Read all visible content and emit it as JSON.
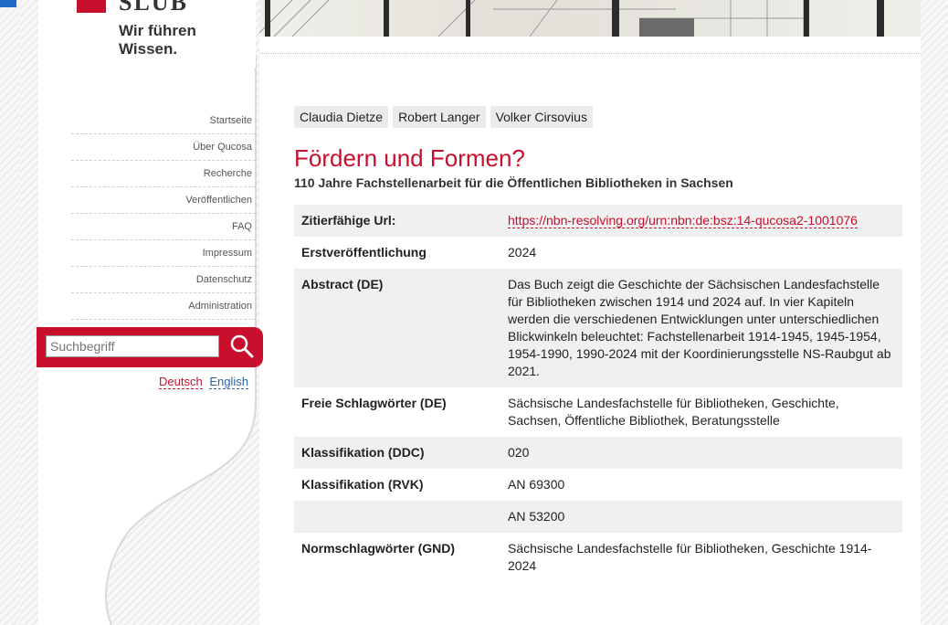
{
  "brand": {
    "logo_word": "SLUB",
    "tagline": "Wir führen Wissen."
  },
  "nav": [
    "Startseite",
    "Über Qucosa",
    "Recherche",
    "Veröffentlichen",
    "FAQ",
    "Impressum",
    "Datenschutz",
    "Administration"
  ],
  "search": {
    "placeholder": "Suchbegriff"
  },
  "languages": {
    "de": "Deutsch",
    "en": "English"
  },
  "authors": [
    "Claudia Dietze",
    "Robert Langer",
    "Volker Cirsovius"
  ],
  "title": "Fördern und Formen?",
  "subtitle": "110 Jahre Fachstellenarbeit für die Öffentlichen Bibliotheken in Sachsen",
  "meta": [
    {
      "k": "Zitierfähige Url:",
      "v": "https://nbn-resolving.org/urn:nbn:de:bsz:14-qucosa2-1001076",
      "link": true
    },
    {
      "k": "Erstveröffentlichung",
      "v": "2024"
    },
    {
      "k": "Abstract (DE)",
      "v": "Das Buch zeigt die Geschichte der Sächsischen Landesfachstelle für Bibliotheken zwischen 1914 und 2024 auf. In vier Kapiteln werden die verschiedenen Entwicklungen unter unterschiedlichen Blickwinkeln beleuchtet: Fachstellenarbeit 1914-1945, 1945-1954, 1954-1990, 1990-2024 mit der Koordinierungsstelle NS-Raubgut ab 2021."
    },
    {
      "k": "Freie Schlagwörter (DE)",
      "v": "Sächsische Landesfachstelle für Bibliotheken, Geschichte, Sachsen, Öffentliche Bibliothek, Beratungsstelle"
    },
    {
      "k": "Klassifikation (DDC)",
      "v": "020"
    },
    {
      "k": "Klassifikation (RVK)",
      "v": "AN 69300"
    },
    {
      "k": "",
      "v": "AN 53200"
    },
    {
      "k": "Normschlagwörter (GND)",
      "v": "Sächsische Landesfachstelle für Bibliotheken, Geschichte 1914-2024"
    }
  ],
  "colors": {
    "brand_red": "#c8102e",
    "link_blue": "#2a62a8"
  }
}
